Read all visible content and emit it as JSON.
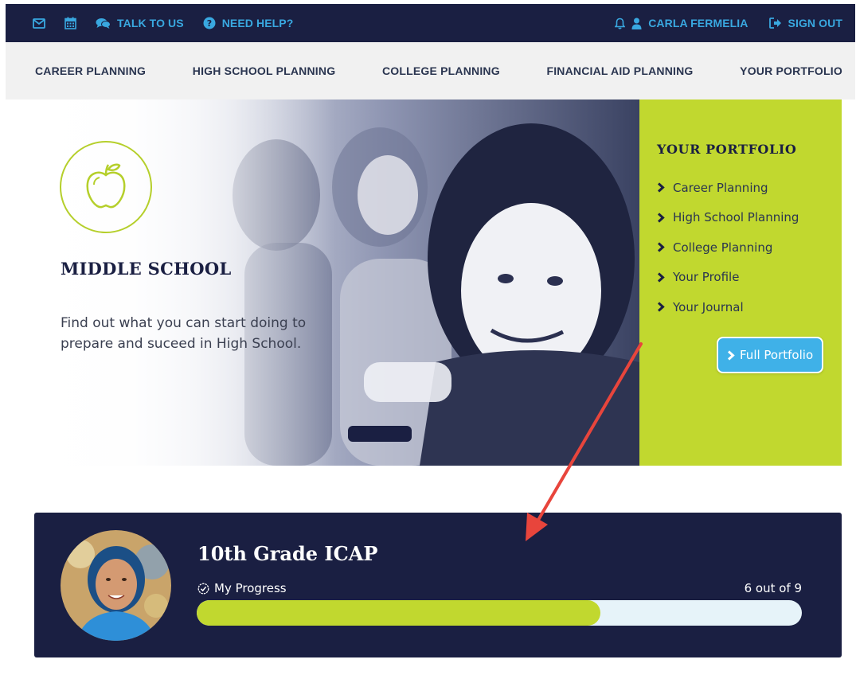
{
  "topbar": {
    "left_items": [
      {
        "icon": "mail-icon"
      },
      {
        "icon": "calendar-icon"
      },
      {
        "icon": "chat-icon",
        "label": "TALK TO US"
      },
      {
        "icon": "help-icon",
        "label": "NEED HELP?"
      }
    ],
    "bell_icon": "bell-icon",
    "user_icon": "user-icon",
    "user_name": "CARLA FERMELIA",
    "signout_icon": "signout-icon",
    "signout_label": "SIGN OUT"
  },
  "nav": {
    "items": [
      "CAREER PLANNING",
      "HIGH SCHOOL PLANNING",
      "COLLEGE PLANNING",
      "FINANCIAL AID PLANNING",
      "YOUR PORTFOLIO"
    ]
  },
  "hero": {
    "icon": "apple-icon",
    "title": "MIDDLE SCHOOL",
    "description": "Find out what you can start doing to prepare and suceed in High School."
  },
  "portfolio": {
    "title": "YOUR PORTFOLIO",
    "links": [
      "Career Planning",
      "High School Planning",
      "College Planning",
      "Your Profile",
      "Your Journal"
    ],
    "button_label": "Full Portfolio"
  },
  "icap": {
    "title": "10th Grade ICAP",
    "progress_label": "My Progress",
    "progress_text": "6 out of 9",
    "progress_completed": 6,
    "progress_total": 9
  },
  "colors": {
    "navy": "#1a1f42",
    "accent_blue": "#39a8e0",
    "lime": "#c1d82f",
    "arrow_red": "#e8453c"
  }
}
